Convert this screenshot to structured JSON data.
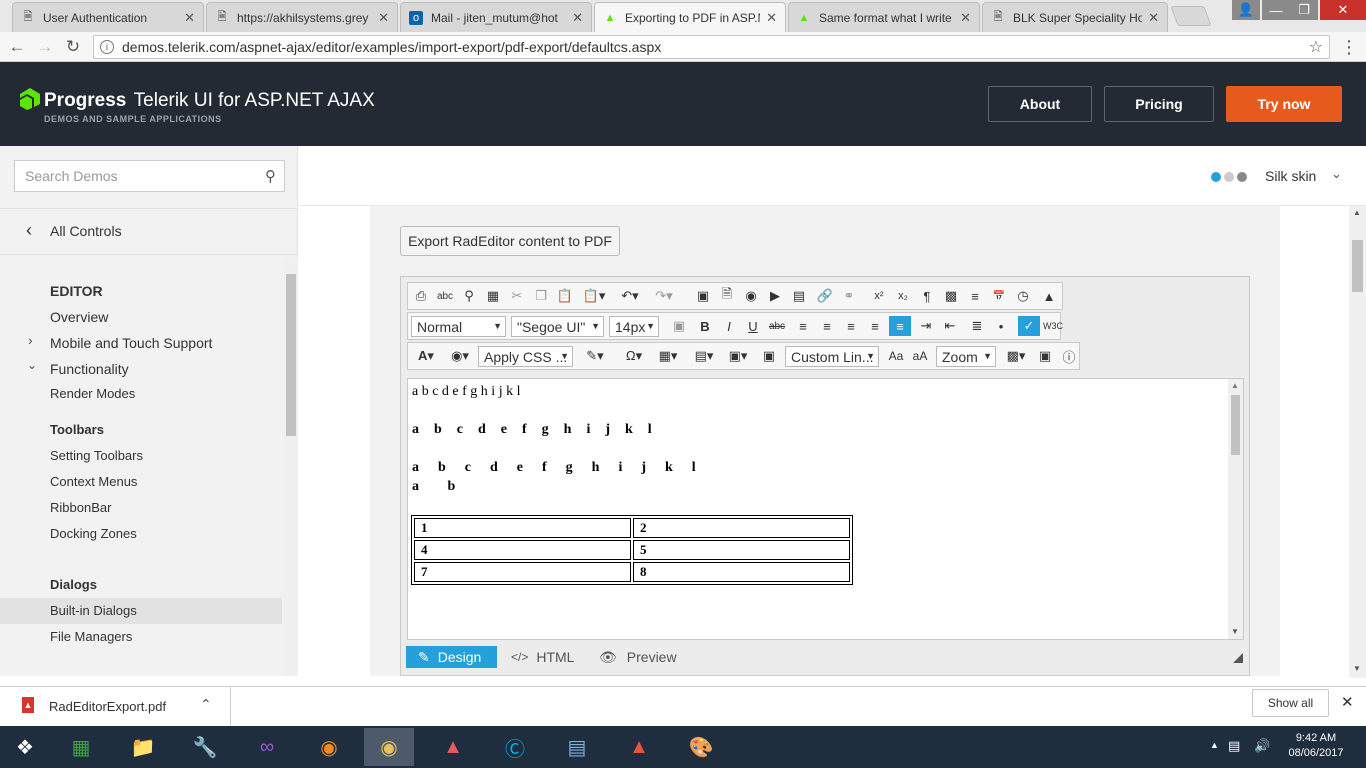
{
  "browser": {
    "tabs": [
      {
        "title": "User Authentication",
        "icon": "document-icon"
      },
      {
        "title": "https://akhilsystems.grey",
        "icon": "document-icon"
      },
      {
        "title": "Mail - jiten_mutum@hot",
        "icon": "outlook-icon"
      },
      {
        "title": "Exporting to PDF in ASP.N",
        "icon": "telerik-icon",
        "active": true
      },
      {
        "title": "Same format what I write",
        "icon": "telerik-icon"
      },
      {
        "title": "BLK Super Speciality Hos",
        "icon": "document-icon"
      }
    ],
    "url": "demos.telerik.com/aspnet-ajax/editor/examples/import-export/pdf-export/defaultcs.aspx"
  },
  "header": {
    "brand": "Progress",
    "product": "Telerik",
    "product_suffix": "UI for ASP.NET AJAX",
    "tagline": "DEMOS AND SAMPLE APPLICATIONS",
    "about": "About",
    "pricing": "Pricing",
    "try_now": "Try now",
    "accent": "#e65a1e"
  },
  "sidebar": {
    "search_placeholder": "Search Demos",
    "back": "All Controls",
    "section": "EDITOR",
    "items": {
      "overview": "Overview",
      "mobile": "Mobile and Touch Support",
      "functionality": "Functionality",
      "render_modes": "Render Modes",
      "toolbars": "Toolbars",
      "setting_toolbars": "Setting Toolbars",
      "context_menus": "Context Menus",
      "ribbonbar": "RibbonBar",
      "docking_zones": "Docking Zones",
      "dialogs": "Dialogs",
      "builtin_dialogs": "Built-in Dialogs",
      "file_managers": "File Managers"
    }
  },
  "skin": {
    "label": "Silk skin"
  },
  "demo": {
    "export_button": "Export RadEditor content to PDF",
    "toolbar": {
      "format": "Normal",
      "font": "\"Segoe UI\"",
      "size": "14px",
      "css": "Apply CSS ...",
      "links": "Custom Lin...",
      "zoom": "Zoom"
    },
    "content": {
      "line1": "a b c d e f g h i j k l",
      "line2": "a  b  c  d  e  f  g  h  i  j  k  l",
      "line3": "a  b  c  d  e  f  g  h  i  j  k  l",
      "line4": "a   b",
      "table": [
        [
          "1",
          "2"
        ],
        [
          "4",
          "5"
        ],
        [
          "7",
          "8"
        ]
      ]
    },
    "modes": {
      "design": "Design",
      "html": "HTML",
      "preview": "Preview"
    }
  },
  "downloads": {
    "file": "RadEditorExport.pdf",
    "show_all": "Show all"
  },
  "taskbar": {
    "time": "9:42 AM",
    "date": "08/06/2017"
  }
}
